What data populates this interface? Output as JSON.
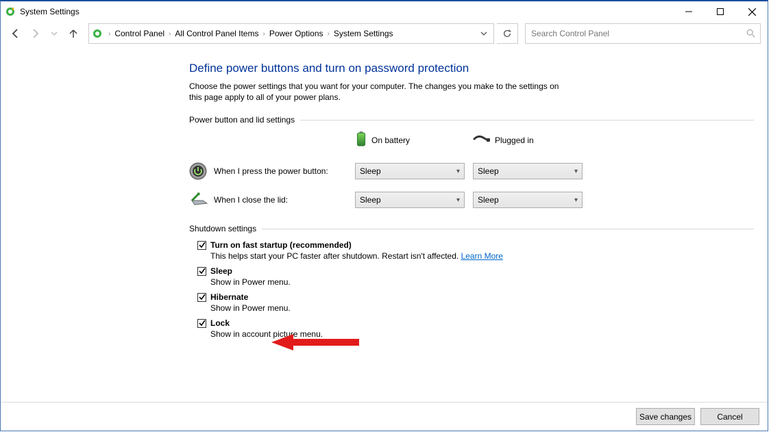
{
  "window": {
    "title": "System Settings"
  },
  "breadcrumb": {
    "items": [
      "Control Panel",
      "All Control Panel Items",
      "Power Options",
      "System Settings"
    ]
  },
  "search": {
    "placeholder": "Search Control Panel"
  },
  "page": {
    "title": "Define power buttons and turn on password protection",
    "description": "Choose the power settings that you want for your computer. The changes you make to the settings on this page apply to all of your power plans."
  },
  "power_section": {
    "heading": "Power button and lid settings",
    "col_battery": "On battery",
    "col_plugged": "Plugged in",
    "rows": [
      {
        "label": "When I press the power button:",
        "battery": "Sleep",
        "plugged": "Sleep"
      },
      {
        "label": "When I close the lid:",
        "battery": "Sleep",
        "plugged": "Sleep"
      }
    ]
  },
  "shutdown_section": {
    "heading": "Shutdown settings",
    "items": [
      {
        "title": "Turn on fast startup (recommended)",
        "desc_prefix": "This helps start your PC faster after shutdown. Restart isn't affected. ",
        "link": "Learn More",
        "checked": true
      },
      {
        "title": "Sleep",
        "desc": "Show in Power menu.",
        "checked": true
      },
      {
        "title": "Hibernate",
        "desc": "Show in Power menu.",
        "checked": true
      },
      {
        "title": "Lock",
        "desc": "Show in account picture menu.",
        "checked": true
      }
    ]
  },
  "footer": {
    "save": "Save changes",
    "cancel": "Cancel"
  }
}
